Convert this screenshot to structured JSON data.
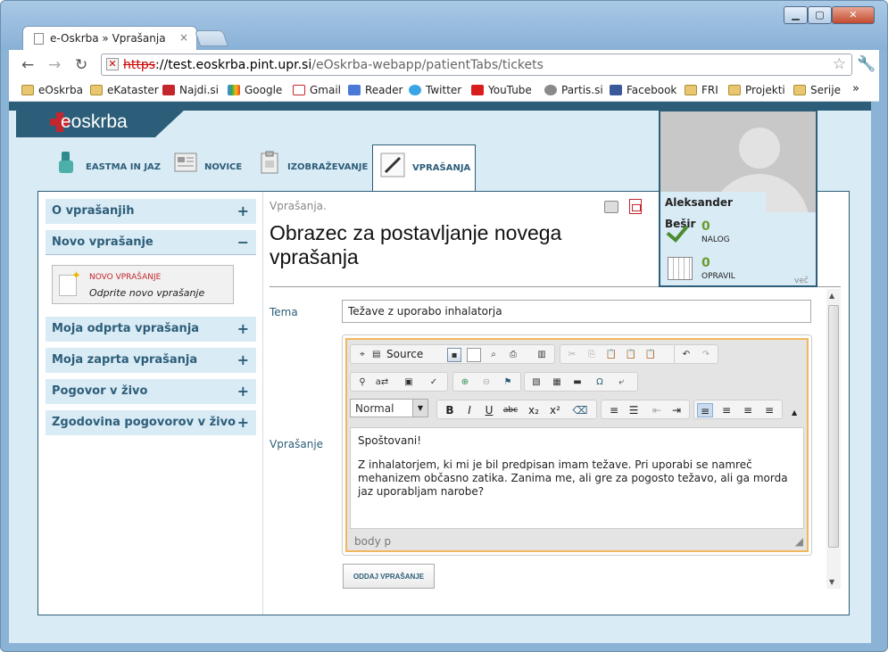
{
  "window": {
    "min": "▁",
    "max": "▢",
    "close": "✕"
  },
  "tab": {
    "title": "e-Oskrba » Vprašanja",
    "close": "×"
  },
  "address": {
    "scheme": "https",
    "host": "://test.eoskrba.pint.upr.si",
    "path": "/eOskrba-webapp/patientTabs/tickets"
  },
  "bookmarks": [
    "eOskrba",
    "eKataster",
    "Najdi.si",
    "Google",
    "Gmail",
    "Reader",
    "Twitter",
    "YouTube",
    "Partis.si",
    "Facebook",
    "FRI",
    "Projekti",
    "Serije"
  ],
  "bookmarks_more": "»",
  "logo": "eoskrba",
  "nav": [
    "EASTMA IN JAZ",
    "NOVICE",
    "IZOBRAŽEVANJE",
    "VPRAŠANJA"
  ],
  "sidebar": {
    "items": [
      "O vprašanjih",
      "Novo vprašanje",
      "Moja odprta vprašanja",
      "Moja zaprta vprašanja",
      "Pogovor v živo",
      "Zgodovina pogovorov v živo"
    ],
    "plus": "+",
    "minus": "−",
    "new_title": "NOVO VPRAŠANJE",
    "new_sub": "Odprite novo vprašanje"
  },
  "breadcrumb": "Vprašanja.",
  "page_title": "Obrazec za postavljanje novega vprašanja",
  "form": {
    "topic_label": "Tema",
    "topic_value": "Težave z uporabo inhalatorja",
    "question_label": "Vprašanje",
    "source_label": "Source",
    "format_value": "Normal",
    "body_p1": "Spoštovani!",
    "body_p2": "Z inhalatorjem, ki mi je bil predpisan imam težave. Pri uporabi se namreč mehanizem občasno zatika. Zanima me, ali gre za pogosto težavo, ali ga morda jaz uporabljam narobe?",
    "status_path": "body  p",
    "submit": "ODDAJ VPRAŠANJE"
  },
  "user": {
    "name": "Aleksander Bešir",
    "nalog_count": "0",
    "nalog_label": "NALOG",
    "opravil_count": "0",
    "opravil_label": "OPRAVIL",
    "more": "več"
  },
  "colors": {
    "brand": "#2d5e79",
    "accent_red": "#c4262d",
    "panel": "#d9ebf5"
  }
}
